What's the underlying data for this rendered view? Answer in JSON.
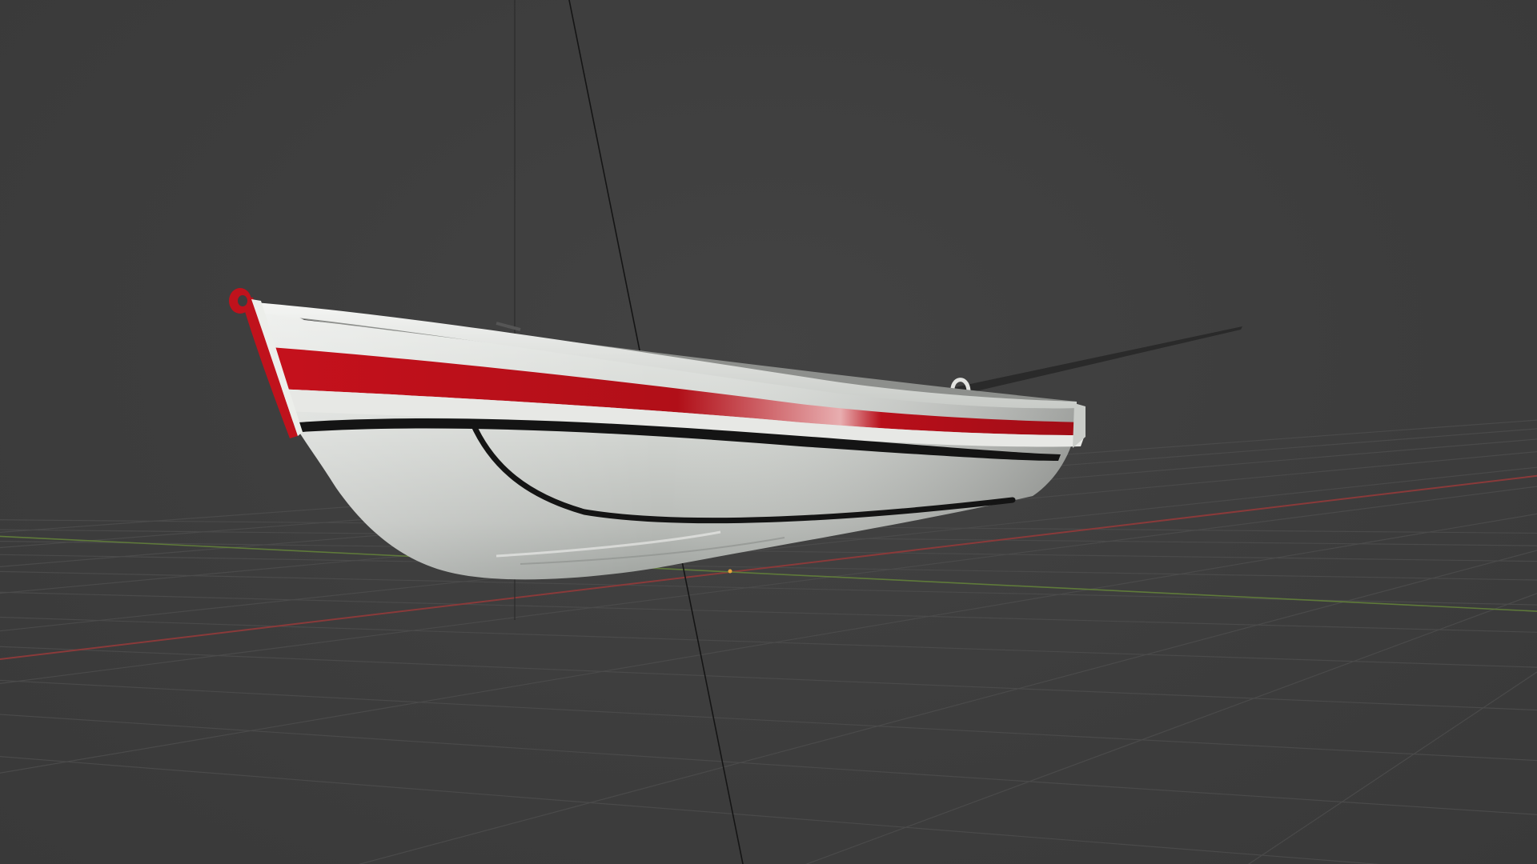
{
  "viewport": {
    "background_color": "#3d3d3d",
    "grid_color": "#4a4a4a",
    "x_axis_color": "#8a3a3a",
    "y_axis_color": "#5f7a3a",
    "z_axis_line_color": "#151515",
    "origin_marker_color": "#e8a33a"
  },
  "scene": {
    "object": "rowboat",
    "hull_color": "#d9dcd8",
    "stripe_color": "#c0121c",
    "waterline_color": "#141414",
    "oar_color": "#2a2a2a"
  }
}
